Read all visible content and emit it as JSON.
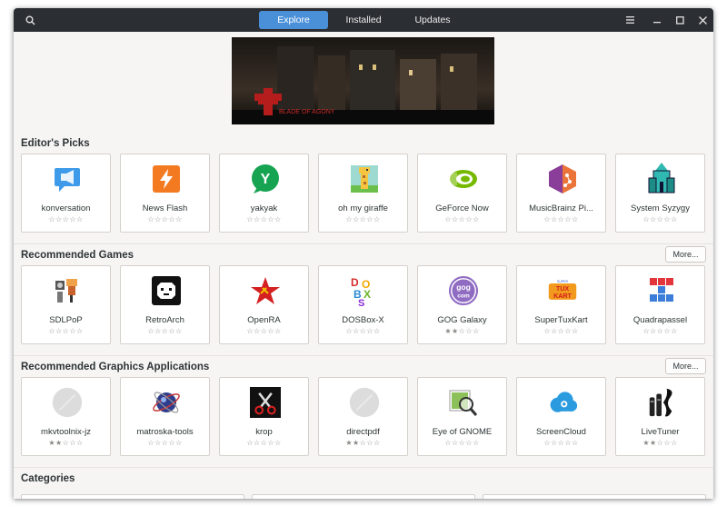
{
  "header": {
    "tabs": [
      {
        "label": "Explore",
        "active": true
      },
      {
        "label": "Installed",
        "active": false
      },
      {
        "label": "Updates",
        "active": false
      }
    ],
    "icons": [
      "search-icon",
      "menu-icon",
      "minimize-icon",
      "maximize-icon",
      "close-icon"
    ]
  },
  "banner": {
    "logo_text": "BLADE OF AGONY"
  },
  "sections": {
    "editors_picks": {
      "title": "Editor's Picks",
      "apps": [
        {
          "name": "konversation",
          "rating": 0
        },
        {
          "name": "News Flash",
          "rating": 0
        },
        {
          "name": "yakyak",
          "rating": 0
        },
        {
          "name": "oh my giraffe",
          "rating": 0
        },
        {
          "name": "GeForce Now",
          "rating": 0
        },
        {
          "name": "MusicBrainz Pi...",
          "rating": 0
        },
        {
          "name": "System Syzygy",
          "rating": 0
        }
      ]
    },
    "games": {
      "title": "Recommended Games",
      "more_label": "More...",
      "apps": [
        {
          "name": "SDLPoP",
          "rating": 0
        },
        {
          "name": "RetroArch",
          "rating": 0
        },
        {
          "name": "OpenRA",
          "rating": 0
        },
        {
          "name": "DOSBox-X",
          "rating": 0
        },
        {
          "name": "GOG Galaxy",
          "rating": 2
        },
        {
          "name": "SuperTuxKart",
          "rating": 0
        },
        {
          "name": "Quadrapassel",
          "rating": 0
        }
      ]
    },
    "graphics": {
      "title": "Recommended Graphics Applications",
      "more_label": "More...",
      "apps": [
        {
          "name": "mkvtoolnix-jz",
          "rating": 2
        },
        {
          "name": "matroska-tools",
          "rating": 0
        },
        {
          "name": "krop",
          "rating": 0
        },
        {
          "name": "directpdf",
          "rating": 2
        },
        {
          "name": "Eye of GNOME",
          "rating": 0
        },
        {
          "name": "ScreenCloud",
          "rating": 0
        },
        {
          "name": "LiveTuner",
          "rating": 2
        }
      ]
    },
    "categories": {
      "title": "Categories",
      "items": [
        "",
        "",
        ""
      ]
    }
  },
  "stars": {
    "empty": "☆☆☆☆☆",
    "two": "★★☆☆☆"
  },
  "colors": {
    "headerbar": "#2b2e33",
    "accent": "#4a90d9",
    "window_bg": "#f6f5f4"
  }
}
